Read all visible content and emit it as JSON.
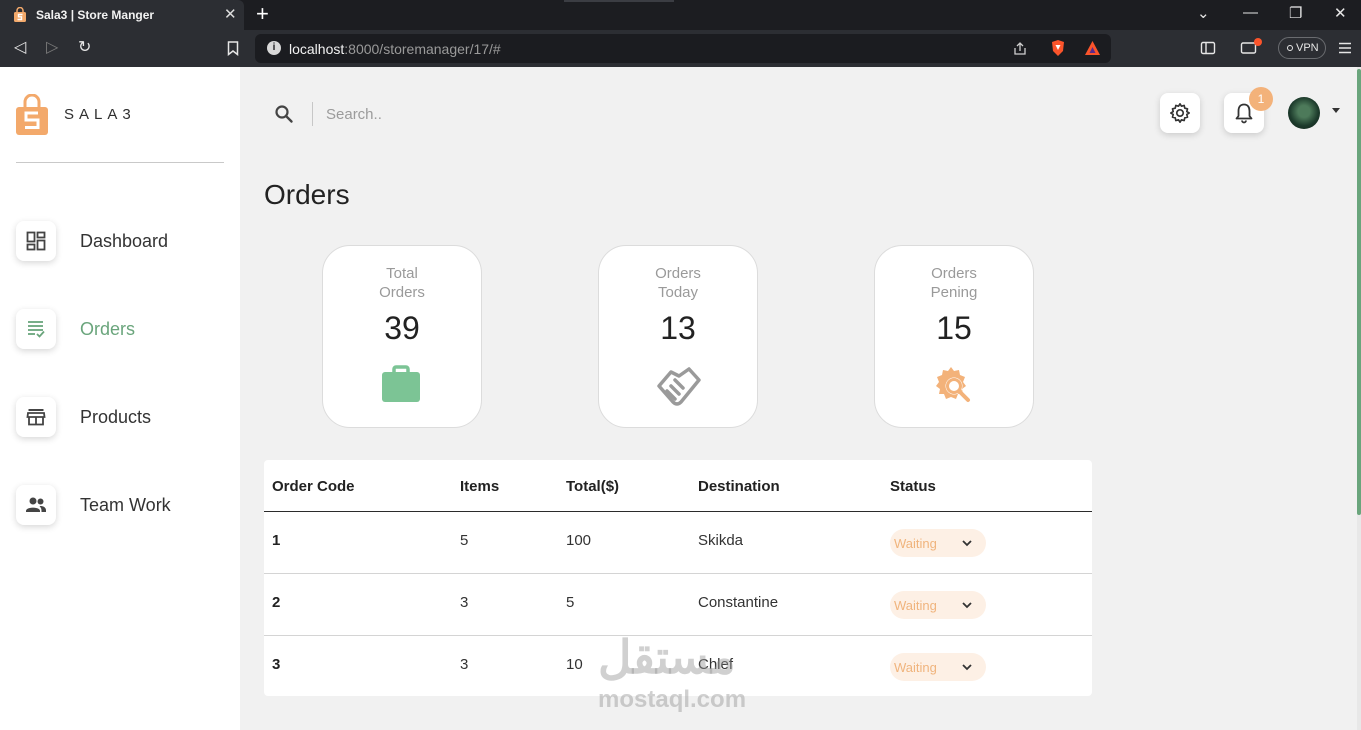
{
  "browser": {
    "tab_title": "Sala3 | Store Manger",
    "tab_close": "✕",
    "new_tab": "+",
    "url_host": "localhost",
    "url_path": ":8000/storemanager/17/#",
    "vpn_label": "VPN",
    "minimize": "⌄",
    "restore": "—",
    "maximize": "❐",
    "close": "✕",
    "back": "◁",
    "forward": "▷",
    "reload": "↻"
  },
  "brand": {
    "name": "SALA3",
    "accent": "#f3a96b"
  },
  "sidebar": {
    "items": [
      {
        "label": "Dashboard",
        "icon": "dashboard-icon"
      },
      {
        "label": "Orders",
        "icon": "orders-icon",
        "active": true
      },
      {
        "label": "Products",
        "icon": "store-icon"
      },
      {
        "label": "Team Work",
        "icon": "people-icon"
      }
    ],
    "active_color": "#6aa57c"
  },
  "header": {
    "search_placeholder": "Search..",
    "notification_count": "1"
  },
  "page": {
    "title": "Orders"
  },
  "stats": [
    {
      "label_line1": "Total",
      "label_line2": "Orders",
      "value": "39",
      "icon": "briefcase-icon",
      "color": "#7cc495"
    },
    {
      "label_line1": "Orders",
      "label_line2": "Today",
      "value": "13",
      "icon": "handshake-icon",
      "color": "#9a9a9a"
    },
    {
      "label_line1": "Orders",
      "label_line2": "Pening",
      "value": "15",
      "icon": "search-gear-icon",
      "color": "#f3b27a"
    }
  ],
  "table": {
    "headers": [
      "Order Code",
      "Items",
      "Total($)",
      "Destination",
      "Status"
    ],
    "rows": [
      {
        "code": "1",
        "items": "5",
        "total": "100",
        "destination": "Skikda",
        "status": "Waiting"
      },
      {
        "code": "2",
        "items": "3",
        "total": "5",
        "destination": "Constantine",
        "status": "Waiting"
      },
      {
        "code": "3",
        "items": "3",
        "total": "10",
        "destination": "Chlef",
        "status": "Waiting"
      }
    ]
  },
  "watermark": {
    "arabic": "مستقل",
    "latin": "mostaql.com"
  }
}
